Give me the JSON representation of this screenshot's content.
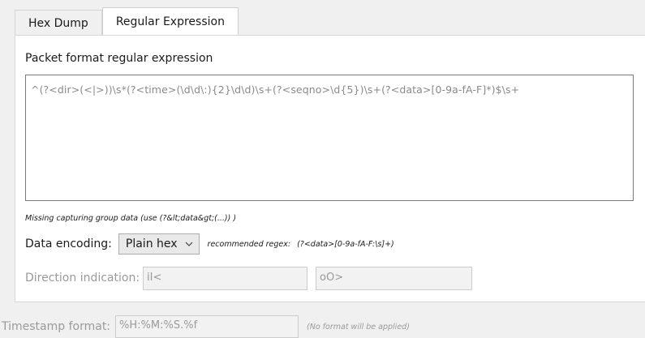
{
  "tabs": [
    {
      "label": "Hex Dump",
      "active": false
    },
    {
      "label": "Regular Expression",
      "active": true
    }
  ],
  "regex": {
    "section_title": "Packet format regular expression",
    "value": "^(?<dir>(<|>))\\s*(?<time>(\\d\\d\\:){2}\\d\\d)\\s+(?<seqno>\\d{5})\\s+(?<data>[0-9a-fA-F]*)$\\s+",
    "missing_note": "Missing capturing group data (use (?&lt;data&gt;(...)) )"
  },
  "encoding": {
    "label": "Data encoding:",
    "selected": "Plain hex",
    "recommended_label": "recommended regex:",
    "recommended_value": "(?<data>[0-9a-fA-F:\\s]+)"
  },
  "direction": {
    "label": "Direction indication:",
    "in_value": "iI<",
    "out_value": "oO>"
  },
  "timestamp": {
    "label": "Timestamp format:",
    "value": "%H:%M:%S.%f",
    "note": "(No format will be applied)"
  },
  "icons": {
    "dropdown": "chevron-down-icon"
  }
}
